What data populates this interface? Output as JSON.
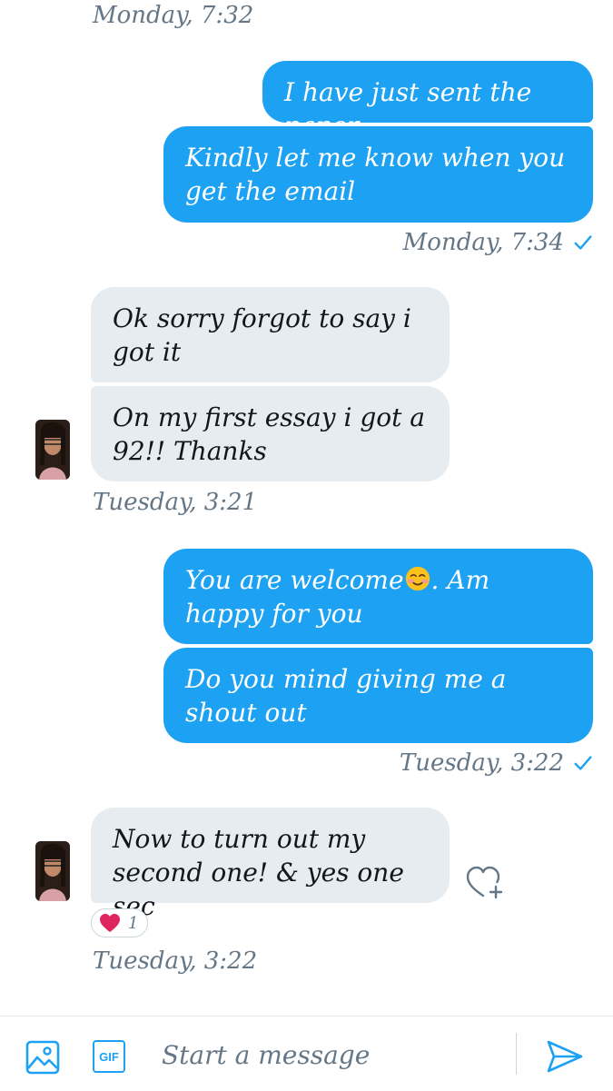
{
  "conversation": {
    "timestamps": {
      "t1": "Monday, 7:32",
      "t2": "Monday, 7:34",
      "t3": "Tuesday, 3:21",
      "t4": "Tuesday, 3:22",
      "t5": "Tuesday, 3:22"
    },
    "messages": [
      {
        "direction": "outgoing",
        "text": "I have just sent the paper"
      },
      {
        "direction": "outgoing",
        "text": "Kindly let me know when you get the email"
      },
      {
        "direction": "incoming",
        "text": "Ok sorry forgot to say i got it"
      },
      {
        "direction": "incoming",
        "text": "On my first essay i got a 92!! Thanks"
      },
      {
        "direction": "outgoing",
        "text_before": "You are welcome",
        "emoji": "smiling-face-icon",
        "text_after": ". Am happy for you"
      },
      {
        "direction": "outgoing",
        "text": "Do you mind giving me a shout out"
      },
      {
        "direction": "incoming",
        "text": "Now to turn out my second one! & yes one sec"
      }
    ],
    "reaction": {
      "icon": "heart-icon",
      "count": "1"
    }
  },
  "composer": {
    "placeholder": "Start a message",
    "gif_label": "GIF",
    "icons": [
      "image-icon",
      "gif-icon",
      "send-icon"
    ]
  },
  "colors": {
    "outgoing_bubble": "#1da1f2",
    "incoming_bubble": "#e6ecf0",
    "accent": "#1da1f2",
    "heart": "#e0245e"
  }
}
